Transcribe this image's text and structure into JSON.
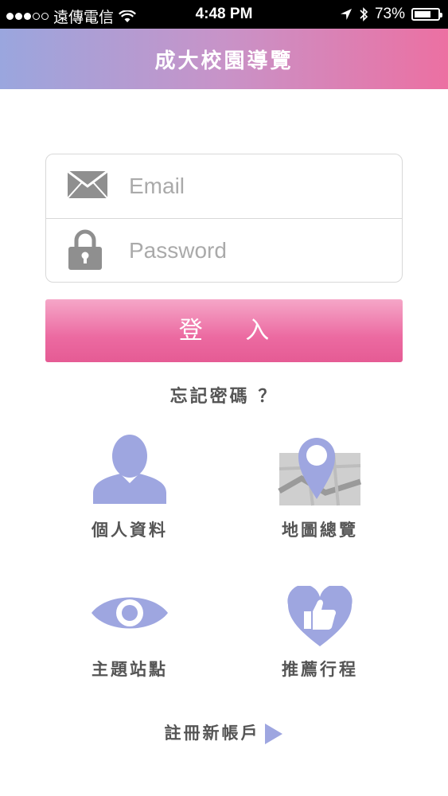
{
  "status_bar": {
    "carrier": "遠傳電信",
    "time": "4:48 PM",
    "battery": "73%",
    "battery_level": 0.73
  },
  "header": {
    "title": "成大校園導覽"
  },
  "login_form": {
    "email_placeholder": "Email",
    "password_placeholder": "Password",
    "login_label": "登 入"
  },
  "forgot_password": "忘記密碼 ？",
  "menu": {
    "profile": "個人資料",
    "map_overview": "地圖總覽",
    "topic_stations": "主題站點",
    "recommended_routes": "推薦行程"
  },
  "register": "註冊新帳戶",
  "colors": {
    "accent_pink": "#ec6aa1",
    "icon_periwinkle": "#9ea6e0",
    "header_gradient_start": "#9aa6de",
    "header_gradient_end": "#ec70a2"
  }
}
